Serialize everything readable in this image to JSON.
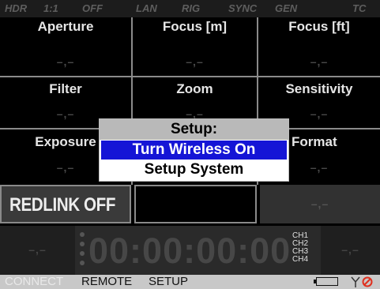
{
  "status_bar": {
    "items": [
      "HDR",
      "1:1",
      "OFF",
      "LAN",
      "RIG",
      "SYNC",
      "GEN",
      "TC"
    ]
  },
  "grid": {
    "cells": [
      {
        "label": "Aperture",
        "value": "–,–"
      },
      {
        "label": "Focus [m]",
        "value": "–,–"
      },
      {
        "label": "Focus [ft]",
        "value": "–,–"
      },
      {
        "label": "Filter",
        "value": "–,–"
      },
      {
        "label": "Zoom",
        "value": "–,–"
      },
      {
        "label": "Sensitivity",
        "value": "–,–"
      },
      {
        "label": "Exposure",
        "value": "–,–"
      },
      {
        "label": "",
        "value": ""
      },
      {
        "label": "Format",
        "value": "–,–"
      }
    ]
  },
  "dialog": {
    "title": "Setup:",
    "items": [
      {
        "label": "Turn Wireless On",
        "selected": true
      },
      {
        "label": "Setup System",
        "selected": false
      }
    ]
  },
  "redlink": {
    "label": "REDLINK OFF",
    "right_value": "–,–"
  },
  "timecode": {
    "left_value": "–,–",
    "value": "00:00:00:00",
    "channels": [
      "CH1",
      "CH2",
      "CH3",
      "CH4"
    ],
    "right_value": "–,–"
  },
  "bottom_bar": {
    "connect_label": "CONNECT",
    "remote_label": "REMOTE",
    "setup_label": "SETUP",
    "icons": [
      "battery-icon",
      "antenna-icon",
      "no-signal-icon"
    ]
  },
  "colors": {
    "menu_highlight": "#1515d6",
    "dialog_title_bg": "#b9b9b9",
    "no_signal": "#e0301e",
    "dim_text": "#4a4a4a"
  }
}
